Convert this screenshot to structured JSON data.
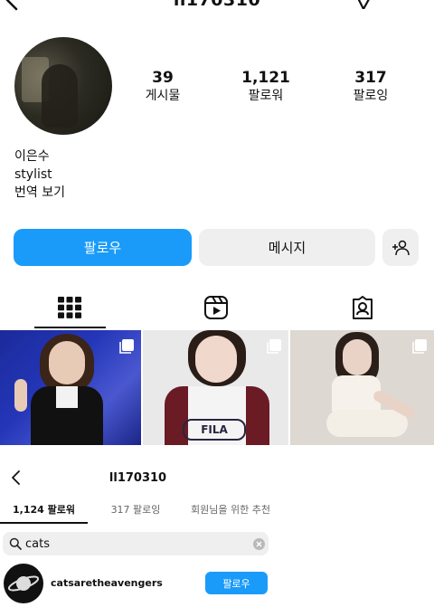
{
  "header": {
    "username": "ll170310",
    "icons": [
      "back-icon",
      "send-icon",
      "more-icon"
    ]
  },
  "stats": [
    {
      "value": "39",
      "label": "게시물"
    },
    {
      "value": "1,121",
      "label": "팔로워"
    },
    {
      "value": "317",
      "label": "팔로잉"
    }
  ],
  "bio": {
    "name": "이은수",
    "role": "stylist",
    "translate": "번역 보기"
  },
  "actions": {
    "follow": "팔로우",
    "message": "메시지"
  },
  "tabs": [
    "grid-icon",
    "reels-icon",
    "tagged-icon"
  ],
  "sheet": {
    "title": "ll170310",
    "tabs": [
      "1,124 팔로워",
      "317 팔로잉",
      "회원님을 위한 추천"
    ],
    "search_value": "cats",
    "user": {
      "name": "catsaretheavengers",
      "follow": "팔로우"
    }
  },
  "colors": {
    "accent": "#1a9bfa",
    "button_gray": "#efefef"
  }
}
